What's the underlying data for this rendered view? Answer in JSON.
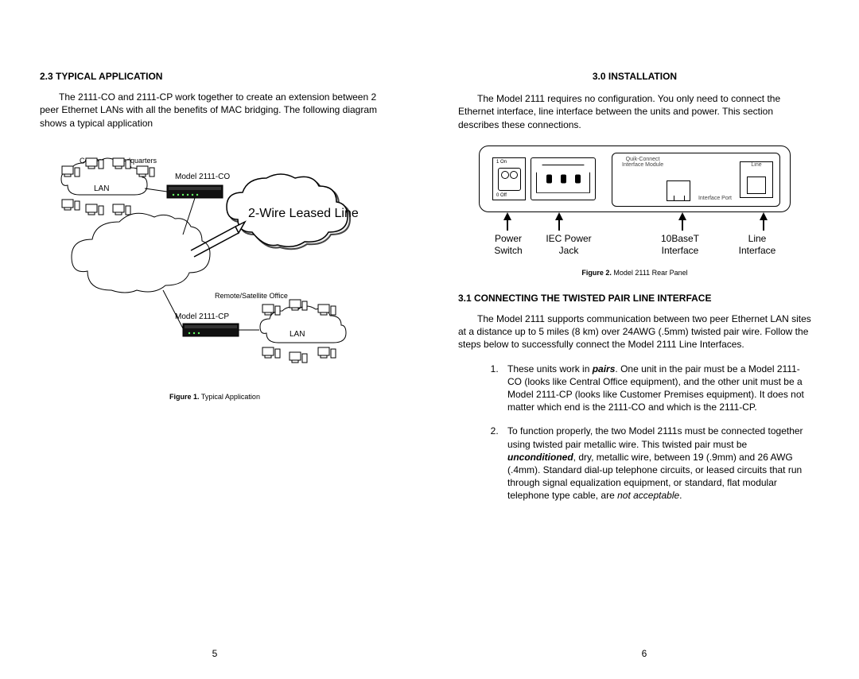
{
  "left": {
    "heading": "2.3 TYPICAL APPLICATION",
    "para": "The 2111-CO and 2111-CP work together to create an extension between 2 peer Ethernet LANs with all the benefits of MAC bridging. The following diagram shows a typical application",
    "fig1": {
      "corp_hq": "Corporate Headquarters",
      "model_co": "Model 2111-CO",
      "lan": "LAN",
      "leased": "2-Wire Leased Line",
      "remote": "Remote/Satellite Office",
      "model_cp": "Model 2111-CP",
      "caption_num": "Figure  1.",
      "caption_text": "  Typical Application"
    },
    "page_num": "5"
  },
  "right": {
    "heading_main": "3.0  INSTALLATION",
    "para_main": "The Model 2111 requires no configuration.  You only need to connect the Ethernet interface, line interface between the units and power.  This section describes these connections.",
    "fig2": {
      "on": "1 On",
      "off": "0 Off",
      "module": "Quik-Connect\nInterface Module",
      "port": "Interface Port",
      "line": "Line",
      "callouts": {
        "power_switch": "Power\nSwitch",
        "iec": "IEC Power\nJack",
        "tenbase": "10BaseT\nInterface",
        "line_if": "Line\nInterface"
      },
      "caption_num": "Figure  2.",
      "caption_text": "  Model 2111 Rear Panel"
    },
    "heading_31": "3.1 CONNECTING THE TWISTED PAIR LINE INTERFACE",
    "para_31": "The Model 2111 supports communication between two peer Ethernet LAN sites at a distance up to 5 miles (8 km) over 24AWG (.5mm) twisted pair wire.  Follow the steps below to successfully connect the Model 2111 Line Interfaces.",
    "step1_a": "These units work in ",
    "step1_pairs": "pairs",
    "step1_b": ".  One unit in the pair must be a Model 2111-CO (looks like Central Office equipment), and the other unit must be a Model 2111-CP (looks like Customer Premises equipment).  It does not matter which end is the 2111-CO and which is the 2111-CP.",
    "step2_a": "To function properly, the two Model 2111s must be connected together using twisted pair metallic wire.  This twisted pair must be ",
    "step2_uncond": "unconditioned",
    "step2_b": ", dry, metallic wire, between 19 (.9mm) and 26 AWG (.4mm).  Standard dial-up telephone circuits, or leased circuits that run through signal equalization equipment, or standard, flat modular telephone type cable, are ",
    "step2_na": "not acceptable",
    "step2_c": ".",
    "page_num": "6"
  }
}
